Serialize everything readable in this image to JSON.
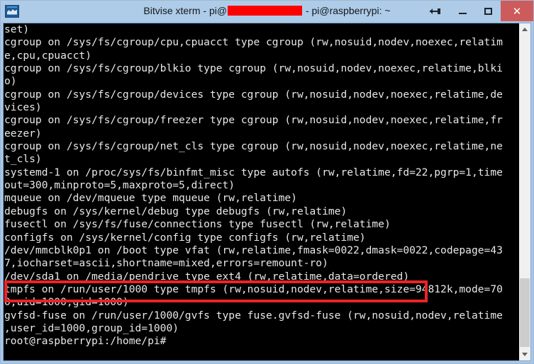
{
  "window": {
    "title_prefix": "Bitvise xterm - pi@",
    "title_redacted": "REDACTED",
    "title_suffix": " - pi@raspberrypi: ~",
    "icon_name": "bitvise-app-icon",
    "buttons": {
      "resize": "resize",
      "minimize": "–",
      "maximize": "□",
      "close": "✕"
    }
  },
  "terminal": {
    "foreground": "#e8e8e8",
    "background": "#000000",
    "prompt": "root@raspberrypi:/home/pi#",
    "lines": [
      "set)",
      "cgroup on /sys/fs/cgroup/cpu,cpuacct type cgroup (rw,nosuid,nodev,noexec,relatim",
      "e,cpu,cpuacct)",
      "cgroup on /sys/fs/cgroup/blkio type cgroup (rw,nosuid,nodev,noexec,relatime,blki",
      "o)",
      "cgroup on /sys/fs/cgroup/devices type cgroup (rw,nosuid,nodev,noexec,relatime,de",
      "vices)",
      "cgroup on /sys/fs/cgroup/freezer type cgroup (rw,nosuid,nodev,noexec,relatime,fr",
      "eezer)",
      "cgroup on /sys/fs/cgroup/net_cls type cgroup (rw,nosuid,nodev,noexec,relatime,ne",
      "t_cls)",
      "systemd-1 on /proc/sys/fs/binfmt_misc type autofs (rw,relatime,fd=22,pgrp=1,time",
      "out=300,minproto=5,maxproto=5,direct)",
      "mqueue on /dev/mqueue type mqueue (rw,relatime)",
      "debugfs on /sys/kernel/debug type debugfs (rw,relatime)",
      "fusectl on /sys/fs/fuse/connections type fusectl (rw,relatime)",
      "configfs on /sys/kernel/config type configfs (rw,relatime)",
      "/dev/mmcblk0p1 on /boot type vfat (rw,relatime,fmask=0022,dmask=0022,codepage=43",
      "7,iocharset=ascii,shortname=mixed,errors=remount-ro)",
      "/dev/sda1 on /media/pendrive type ext4 (rw,relatime,data=ordered)",
      "tmpfs on /run/user/1000 type tmpfs (rw,nosuid,nodev,relatime,size=94812k,mode=70",
      "0,uid=1000,gid=1000)",
      "gvfsd-fuse on /run/user/1000/gvfs type fuse.gvfsd-fuse (rw,nosuid,nodev,relatime",
      ",user_id=1000,group_id=1000)",
      "root@raspberrypi:/home/pi#"
    ],
    "highlighted_line": "/dev/sda1 on /media/pendrive type ext4 (rw,relatime,data=ordered)",
    "highlight_color": "#ec2227"
  },
  "scrollbar": {
    "up_arrow": "scroll-up",
    "down_arrow": "scroll-down",
    "thumb": "scroll-thumb"
  }
}
